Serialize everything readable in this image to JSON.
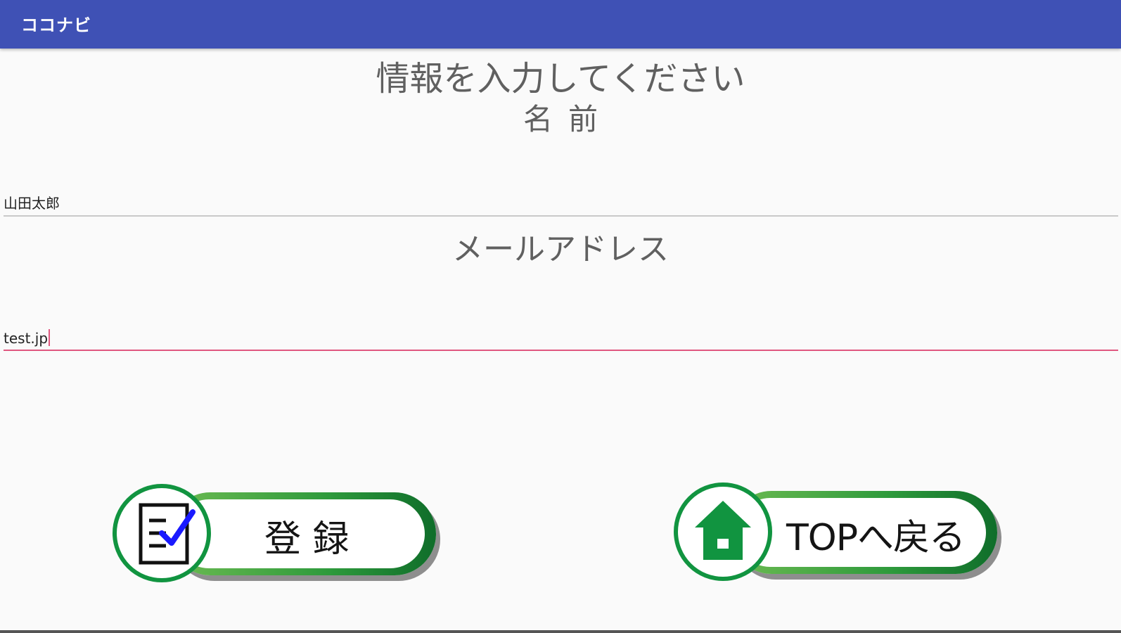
{
  "appbar": {
    "title": "ココナビ"
  },
  "form": {
    "heading": "情報を入力してください",
    "name_label": "名前",
    "name_value": "山田太郎",
    "email_label": "メールアドレス",
    "email_value": "test.jp"
  },
  "buttons": {
    "register_label": "登 録",
    "top_label": "TOPへ戻る"
  },
  "colors": {
    "appbar": "#3f51b5",
    "accent_green": "#119440",
    "focus_underline": "#e0577f",
    "check_blue": "#1a1aff"
  },
  "icons": {
    "register": "checklist-icon",
    "top": "home-icon"
  }
}
